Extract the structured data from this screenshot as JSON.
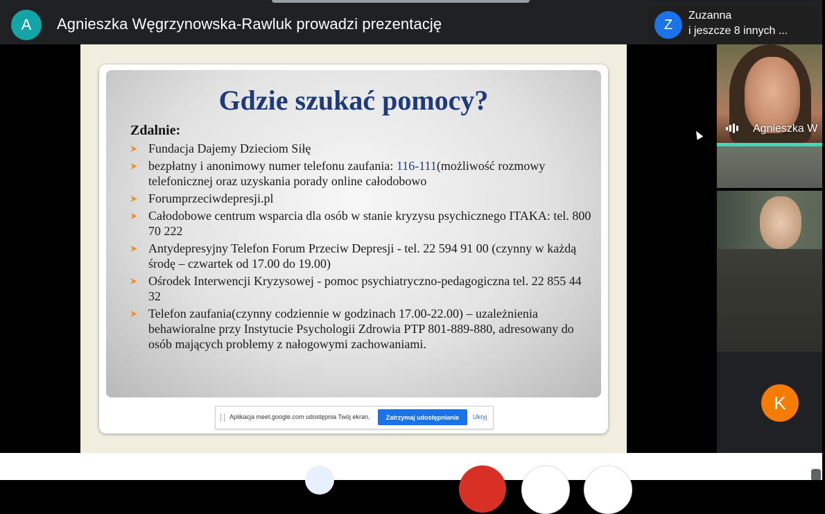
{
  "header": {
    "presenter_avatar_letter": "A",
    "presenter_title": "Agnieszka Węgrzynowska-Rawluk prowadzi prezentację",
    "participants_avatar_letter": "Z",
    "participants_name": "Zuzanna",
    "participants_more": "i jeszcze 8 innych ..."
  },
  "slide": {
    "title": "Gdzie szukać pomocy?",
    "subtitle": "Zdalnie:",
    "bullets": [
      "Fundacja Dajemy Dzieciom Siłę",
      "bezpłatny i anonimowy numer telefonu zaufania: ",
      "Forumprzeciwdepresji.pl",
      "Całodobowe centrum wsparcia dla osób w stanie kryzysu psychicznego ITAKA: tel. 800 70 222",
      "Antydepresyjny Telefon Forum Przeciw Depresji - tel. 22 594 91 00 (czynny w każdą środę – czwartek od 17.00 do 19.00)",
      "Ośrodek Interwencji Kryzysowej - pomoc psychiatryczno-pedagogiczna tel. 22 855 44 32",
      "Telefon zaufania(czynny codziennie w godzinach 17.00-22.00)  – uzależnienia behawioralne przy Instytucie Psychologii Zdrowia PTP 801-889-880, adresowany do osób mających problemy z nałogowymi zachowaniami."
    ],
    "bullet2_number": "116-111",
    "bullet2_tail": "(możliwość rozmowy telefonicznej oraz uzyskania porady online całodobowo"
  },
  "share_bar": {
    "text": "Aplikacja meet.google.com udostępnia Twój ekran.",
    "stop_label": "Zatrzymaj udostępnianie",
    "hide_label": "Ukryj"
  },
  "tiles": {
    "speaker_name": "Agnieszka W",
    "avatar_k_letter": "K"
  },
  "colors": {
    "accent_blue": "#1a73e8",
    "speaking_highlight": "#3ddbb4",
    "end_call_red": "#d93025",
    "avatar_orange": "#f57c00",
    "avatar_teal": "#12a4a6"
  }
}
